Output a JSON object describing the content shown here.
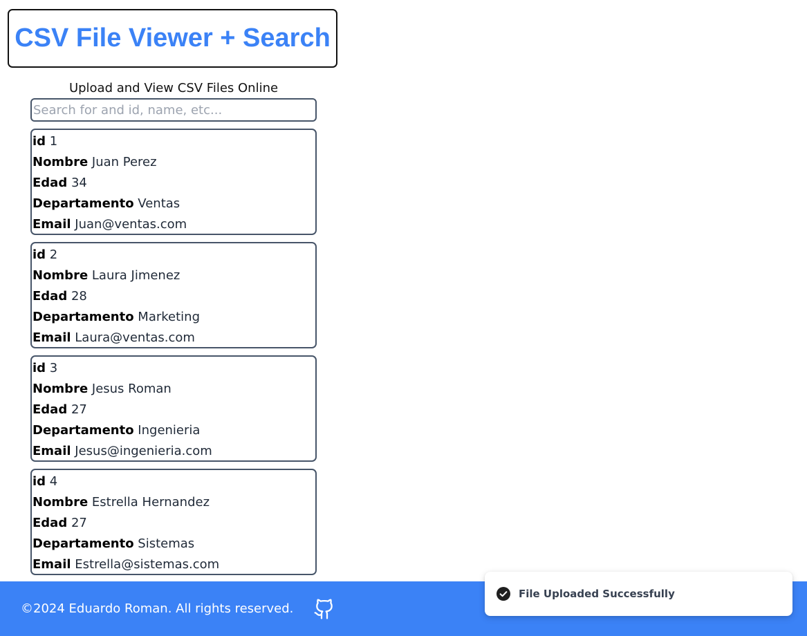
{
  "header": {
    "title": "CSV File Viewer + Search",
    "subtitle": "Upload and View CSV Files Online"
  },
  "search": {
    "placeholder": "Search for and id, name, etc...",
    "value": ""
  },
  "records": [
    {
      "fields": [
        {
          "key": "id",
          "value": "1"
        },
        {
          "key": "Nombre",
          "value": "Juan Perez"
        },
        {
          "key": "Edad",
          "value": "34"
        },
        {
          "key": "Departamento",
          "value": "Ventas"
        },
        {
          "key": "Email",
          "value": "Juan@ventas.com"
        }
      ]
    },
    {
      "fields": [
        {
          "key": "id",
          "value": "2"
        },
        {
          "key": "Nombre",
          "value": "Laura Jimenez"
        },
        {
          "key": "Edad",
          "value": "28"
        },
        {
          "key": "Departamento",
          "value": "Marketing"
        },
        {
          "key": "Email",
          "value": "Laura@ventas.com"
        }
      ]
    },
    {
      "fields": [
        {
          "key": "id",
          "value": "3"
        },
        {
          "key": "Nombre",
          "value": "Jesus Roman"
        },
        {
          "key": "Edad",
          "value": "27"
        },
        {
          "key": "Departamento",
          "value": "Ingenieria"
        },
        {
          "key": "Email",
          "value": "Jesus@ingenieria.com"
        }
      ]
    },
    {
      "fields": [
        {
          "key": "id",
          "value": "4"
        },
        {
          "key": "Nombre",
          "value": "Estrella Hernandez"
        },
        {
          "key": "Edad",
          "value": "27"
        },
        {
          "key": "Departamento",
          "value": "Sistemas"
        },
        {
          "key": "Email",
          "value": "Estrella@sistemas.com"
        }
      ]
    }
  ],
  "footer": {
    "copyright": "©2024 Eduardo Roman. All rights reserved.",
    "icon": "github-icon"
  },
  "toast": {
    "message": "File Uploaded Successfully",
    "icon": "check-circle-icon"
  },
  "colors": {
    "accent": "#3b82f6",
    "border": "#475569",
    "footer_bg": "#3b82f6"
  }
}
